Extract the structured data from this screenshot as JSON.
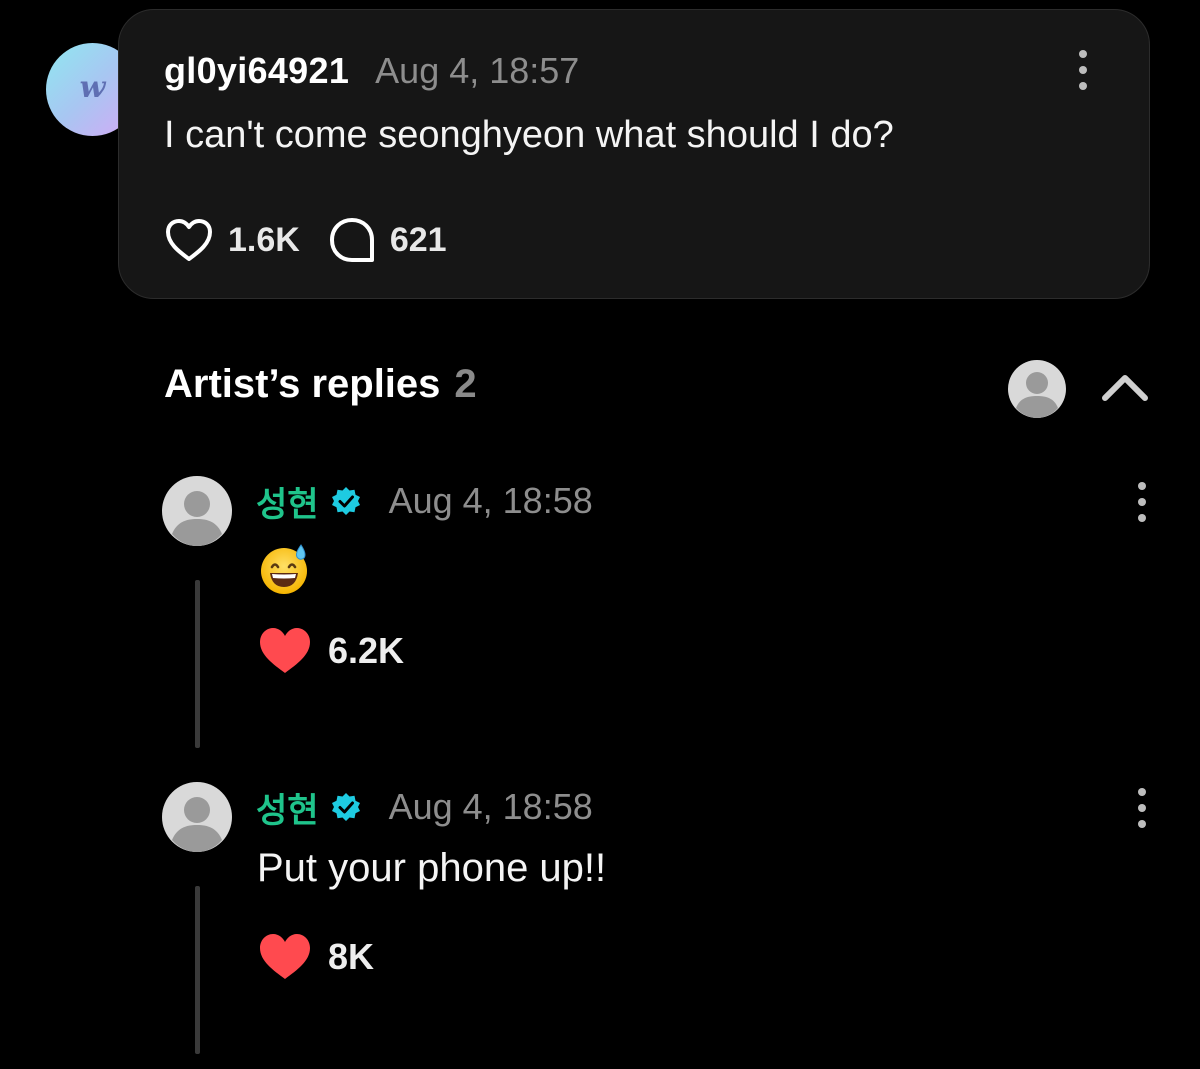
{
  "post": {
    "username": "gl0yi64921",
    "timestamp": "Aug 4, 18:57",
    "text": "I can't come seonghyeon what should I do?",
    "likes": "1.6K",
    "comments": "621",
    "avatar_logo": "w"
  },
  "artist_replies": {
    "title": "Artist’s replies",
    "count": "2"
  },
  "replies": [
    {
      "name": "성현",
      "timestamp": "Aug 4, 18:58",
      "text": "",
      "emoji": "grinning-face-with-sweat",
      "likes": "6.2K"
    },
    {
      "name": "성현",
      "timestamp": "Aug 4, 18:58",
      "text": "Put your phone up!!",
      "likes": "8K"
    }
  ],
  "colors": {
    "background": "#000000",
    "card": "#161616",
    "artist_name": "#1fc48b",
    "verified_badge": "#1ecbe1",
    "like_red": "#ff4a4f",
    "muted_text": "#8d8d8d"
  },
  "icons": {
    "post_like": "heart-outline-icon",
    "post_comment": "speech-bubble-icon",
    "reply_like": "heart-filled-icon",
    "more": "more-vertical-icon",
    "collapse": "chevron-up-icon",
    "verified": "verified-badge-icon",
    "avatar_placeholder": "user-avatar-placeholder-icon"
  }
}
